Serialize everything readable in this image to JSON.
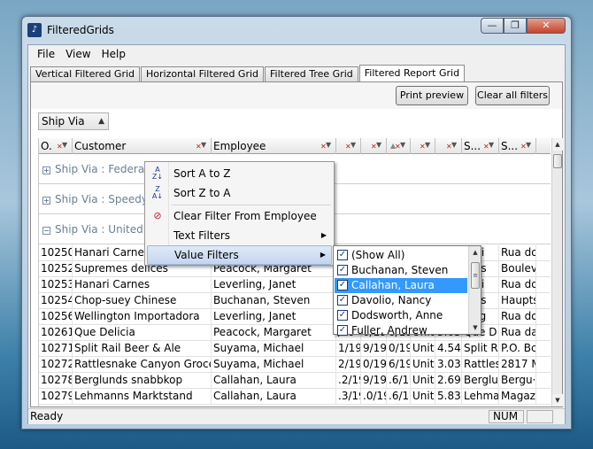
{
  "window": {
    "title": "FilteredGrids",
    "icon": "app-logo-icon"
  },
  "menu": [
    {
      "label": "File",
      "mnemonic": "F"
    },
    {
      "label": "View",
      "mnemonic": "V"
    },
    {
      "label": "Help",
      "mnemonic": "H"
    }
  ],
  "tabs": [
    {
      "label": "Vertical Filtered Grid"
    },
    {
      "label": "Horizontal Filtered Grid"
    },
    {
      "label": "Filtered Tree Grid"
    },
    {
      "label": "Filtered Report Grid",
      "active": true
    }
  ],
  "toolbar": {
    "print_preview": "Print preview",
    "clear_all_filters": "Clear all filters"
  },
  "group_by": {
    "label": "Ship Via"
  },
  "columns": {
    "order": "O.",
    "customer": "Customer",
    "employee": "Employee",
    "c4": "",
    "c5": "",
    "c6": "",
    "c7": "",
    "c8": "",
    "c9": "S...",
    "c10": "S..."
  },
  "groups": [
    {
      "label": "Ship Via : Federal S",
      "expanded": false
    },
    {
      "label": "Ship Via : Speedy E",
      "expanded": false
    },
    {
      "label": "Ship Via : United P",
      "expanded": true
    }
  ],
  "rows": [
    {
      "order": "10250",
      "customer": "Hanari Carnes",
      "employee": "",
      "c4": "",
      "c5": "",
      "c6": "",
      "c7": "",
      "c8": "",
      "c9": "hari",
      "c10": "Rua do"
    },
    {
      "order": "10252",
      "customer": "Supremes delices",
      "employee": "Peacock, Margaret",
      "c4": "",
      "c5": "",
      "c6": "",
      "c7": "",
      "c8": "",
      "c9": "ores",
      "c10": "Boulev"
    },
    {
      "order": "10253",
      "customer": "Hanari Carnes",
      "employee": "Leverling, Janet",
      "c4": "",
      "c5": "",
      "c6": "",
      "c7": "",
      "c8": "",
      "c9": "hari",
      "c10": "Rua do"
    },
    {
      "order": "10254",
      "customer": "Chop-suey Chinese",
      "employee": "Buchanan, Steven",
      "c4": "",
      "c5": "",
      "c6": "",
      "c7": "",
      "c8": "",
      "c9": "op-s",
      "c10": "Haupts"
    },
    {
      "order": "10256",
      "customer": "Wellington Importadora",
      "employee": "Leverling, Janet",
      "c4": "",
      "c5": "",
      "c6": "",
      "c7": "",
      "c8": "",
      "c9": "lling",
      "c10": "Rua do"
    },
    {
      "order": "10261",
      "customer": "Que Delicia",
      "employee": "Peacock, Margaret",
      "c4": "/19",
      "c5": "0/19",
      "c6": "0/19",
      "c7": "Unite",
      "c8": "3.05",
      "c9": "Que D",
      "c10": "Rua da"
    },
    {
      "order": "10271",
      "customer": "Split Rail Beer & Ale",
      "employee": "Suyama, Michael",
      "c4": "1/19",
      "c5": "9/19",
      "c6": "0/19",
      "c7": "Unite",
      "c8": "4.54",
      "c9": "Split Ra",
      "c10": "P.O. Bc"
    },
    {
      "order": "10272",
      "customer": "Rattlesnake Canyon Grocery",
      "employee": "Suyama, Michael",
      "c4": "2/19",
      "c5": "0/19",
      "c6": "6/19",
      "c7": "Unite",
      "c8": "3.03",
      "c9": "Rattlesr",
      "c10": "2817 M"
    },
    {
      "order": "10278",
      "customer": "Berglunds snabbkop",
      "employee": "Callahan, Laura",
      "c4": ".2/19",
      "c5": "9/19",
      "c6": ".6/19",
      "c7": "Unite",
      "c8": "2.69",
      "c9": "Berglur",
      "c10": "Bergu·"
    },
    {
      "order": "10279",
      "customer": "Lehmanns Marktstand",
      "employee": "Callahan, Laura",
      "c4": ".3/19",
      "c5": ".0/19",
      "c6": ".6/19",
      "c7": "Unite",
      "c8": "5.83",
      "c9": "Lehma",
      "c10": "Magazi"
    }
  ],
  "context_menu": {
    "sort_asc": "Sort A to Z",
    "sort_desc": "Sort Z to A",
    "clear_filter": "Clear Filter From Employee",
    "text_filters": "Text Filters",
    "value_filters": "Value Filters"
  },
  "value_filters": [
    {
      "label": "(Show All)",
      "checked": true,
      "selected": false
    },
    {
      "label": "Buchanan, Steven",
      "checked": true,
      "selected": false
    },
    {
      "label": "Callahan, Laura",
      "checked": true,
      "selected": true
    },
    {
      "label": "Davolio, Nancy",
      "checked": true,
      "selected": false
    },
    {
      "label": "Dodsworth, Anne",
      "checked": true,
      "selected": false
    },
    {
      "label": "Fuller, Andrew",
      "checked": true,
      "selected": false
    }
  ],
  "status": {
    "ready": "Ready",
    "num": "NUM"
  },
  "colors": {
    "selection": "#3399ff",
    "group_label": "#6a7f96",
    "menu_highlight": "#c3d6f0"
  }
}
